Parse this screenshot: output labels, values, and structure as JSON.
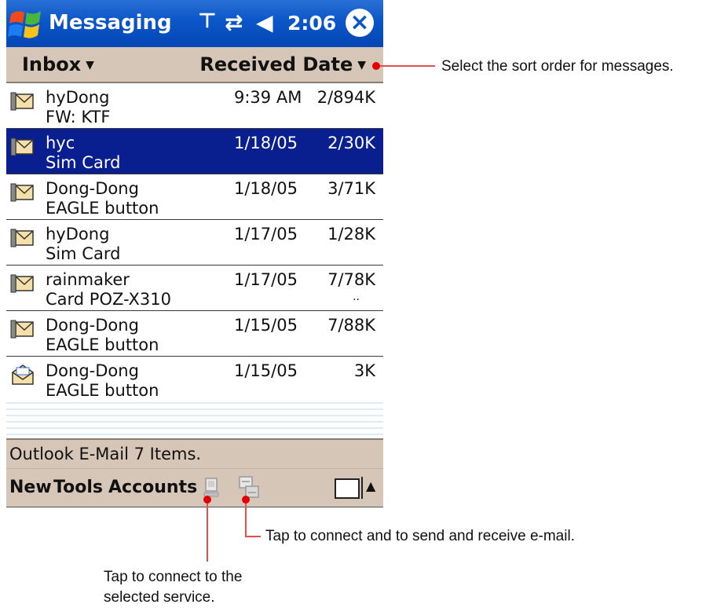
{
  "titlebar": {
    "app_title": "Messaging",
    "time": "2:06",
    "icons": [
      "start-menu-icon",
      "antenna-icon",
      "sync-icon",
      "volume-icon",
      "close-icon"
    ]
  },
  "header": {
    "folder": "Inbox",
    "sort": "Received Date"
  },
  "messages": [
    {
      "from": "hyDong",
      "subject": "FW: KTF",
      "date": "9:39 AM",
      "size": "2/894K",
      "icon": "reply-envelope-icon",
      "selected": false
    },
    {
      "from": "hyc",
      "subject": "Sim Card",
      "date": "1/18/05",
      "size": "2/30K",
      "icon": "reply-envelope-icon",
      "selected": true
    },
    {
      "from": "Dong-Dong",
      "subject": "EAGLE button",
      "date": "1/18/05",
      "size": "3/71K",
      "icon": "reply-envelope-icon",
      "selected": false
    },
    {
      "from": "hyDong",
      "subject": "Sim Card",
      "date": "1/17/05",
      "size": "1/28K",
      "icon": "reply-envelope-icon",
      "selected": false
    },
    {
      "from": "rainmaker",
      "subject": "Card POZ-X310",
      "date": "1/17/05",
      "size": "7/78K",
      "icon": "reply-envelope-icon",
      "selected": false,
      "more": ".."
    },
    {
      "from": "Dong-Dong",
      "subject": "EAGLE button",
      "date": "1/15/05",
      "size": "7/88K",
      "icon": "reply-envelope-icon",
      "selected": false
    },
    {
      "from": "Dong-Dong",
      "subject": "EAGLE button",
      "date": "1/15/05",
      "size": "3K",
      "icon": "open-envelope-icon",
      "selected": false
    }
  ],
  "status": {
    "text": "Outlook E-Mail  7 Items."
  },
  "menubar": {
    "new": "New",
    "tools": "Tools",
    "accounts": "Accounts"
  },
  "callouts": {
    "sort": "Select the sort order for messages.",
    "send_receive": "Tap to connect and to send and receive e-mail.",
    "connect": "Tap to connect to the selected service."
  },
  "colors": {
    "titlebar": "#0a56c8",
    "selected_row": "#0a1f8f",
    "bar": "#d6c6b8",
    "callout": "#e00000"
  }
}
